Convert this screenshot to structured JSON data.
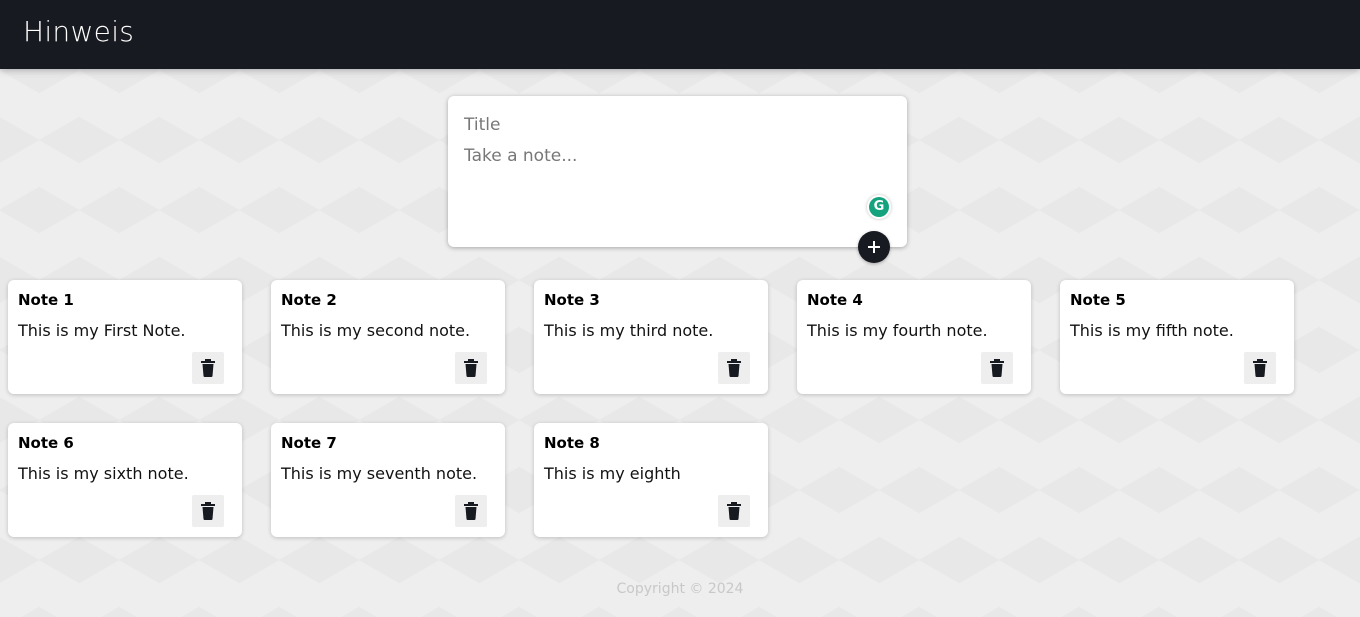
{
  "header": {
    "title": "Hinweis"
  },
  "create_form": {
    "title_placeholder": "Title",
    "content_placeholder": "Take a note...",
    "grammarly_letter": "G",
    "add_icon": "plus-icon"
  },
  "notes": [
    {
      "title": "Note 1",
      "content": "This is my First Note."
    },
    {
      "title": "Note 2",
      "content": "This is my second note."
    },
    {
      "title": "Note 3",
      "content": "This is my third note."
    },
    {
      "title": "Note 4",
      "content": "This is my fourth note."
    },
    {
      "title": "Note 5",
      "content": "This is my fifth note."
    },
    {
      "title": "Note 6",
      "content": "This is my sixth note."
    },
    {
      "title": "Note 7",
      "content": "This is my seventh note."
    },
    {
      "title": "Note 8",
      "content": "This is my eighth"
    }
  ],
  "footer": {
    "copyright": "Copyright © 2024"
  },
  "colors": {
    "header_bg": "#181a21",
    "page_bg": "#eeeeee",
    "card_bg": "#ffffff",
    "grammarly_green": "#15a37e"
  }
}
